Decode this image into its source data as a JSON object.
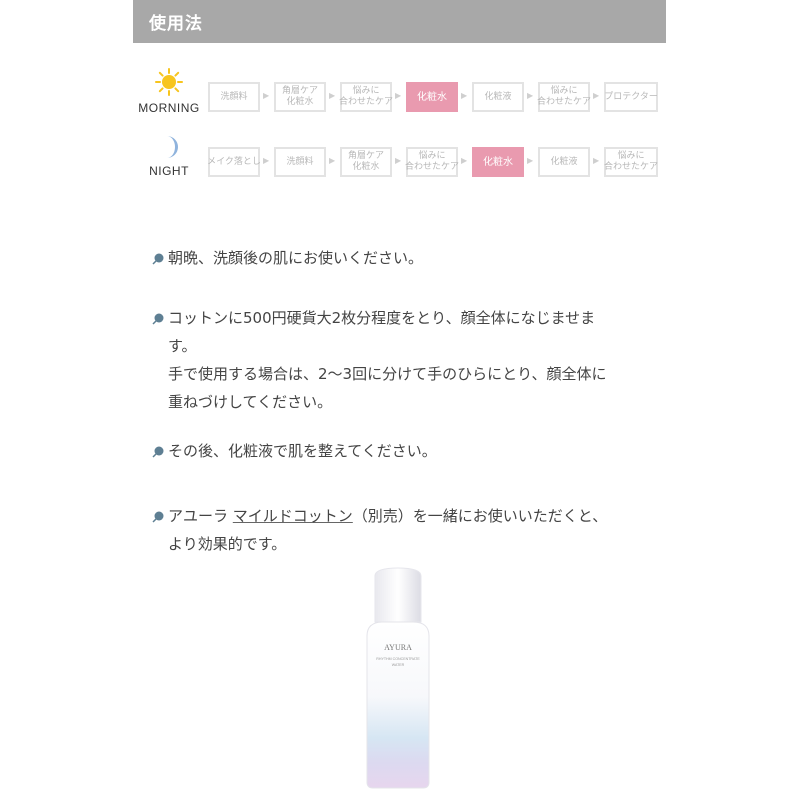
{
  "header": {
    "title": "使用法"
  },
  "routines": {
    "morning": {
      "label": "MORNING",
      "icon": "sun-icon",
      "steps": [
        "洗顔料",
        "角層ケア\n化粧水",
        "悩みに\n合わせたケア",
        "化粧水",
        "化粧液",
        "悩みに\n合わせたケア",
        "プロテクター"
      ],
      "active_index": 3
    },
    "night": {
      "label": "NIGHT",
      "icon": "moon-icon",
      "steps": [
        "メイク落とし",
        "洗顔料",
        "角層ケア\n化粧水",
        "悩みに\n合わせたケア",
        "化粧水",
        "化粧液",
        "悩みに\n合わせたケア"
      ],
      "active_index": 4
    }
  },
  "instructions": {
    "p1": "朝晩、洗顔後の肌にお使いください。",
    "p2": "コットンに500円硬貨大2枚分程度をとり、顔全体になじませま\nす。\n手で使用する場合は、2～3回に分けて手のひらにとり、顔全体に\n重ねづけしてください。",
    "p3": "その後、化粧液で肌を整えてください。",
    "p4_prefix": "アユーラ ",
    "p4_link": "マイルドコットン",
    "p4_suffix": "（別売）を一緒にお使いいただくと、\nより効果的です。"
  },
  "product": {
    "brand": "AYURA",
    "line1": "RHYTHM CONCENTRATE",
    "line2": "WATER"
  },
  "colors": {
    "header_bg": "#a8a8a8",
    "active_step": "#e99aaf",
    "sun": "#f7c51e",
    "moon": "#8fb3dd"
  }
}
